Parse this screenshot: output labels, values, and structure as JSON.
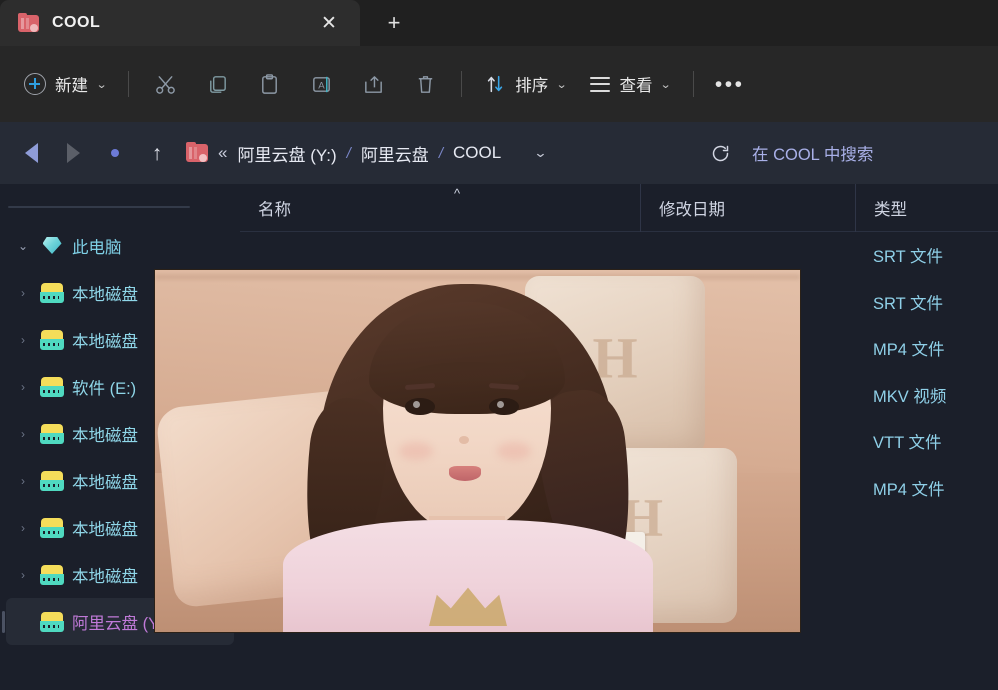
{
  "window": {
    "tab": {
      "title": "COOL",
      "folder_icon": "folder-icon",
      "close_icon": "close-icon"
    },
    "new_tab_icon": "plus-icon"
  },
  "toolbar": {
    "new_label": "新建",
    "new_icon": "plus-circle-icon",
    "caret": "⌄",
    "items": [
      {
        "name": "cut",
        "icon": "scissors-icon"
      },
      {
        "name": "copy",
        "icon": "copy-icon"
      },
      {
        "name": "paste",
        "icon": "clipboard-icon"
      },
      {
        "name": "rename",
        "icon": "rename-icon"
      },
      {
        "name": "share",
        "icon": "share-icon"
      },
      {
        "name": "delete",
        "icon": "trash-icon"
      }
    ],
    "sort_label": "排序",
    "sort_icon": "sort-arrows-icon",
    "view_label": "查看",
    "view_icon": "hamburger-icon",
    "more_label": "•••"
  },
  "addressbar": {
    "back_icon": "back-arrow-icon",
    "forward_icon": "forward-arrow-icon",
    "recent_icon": "recent-dot-icon",
    "up_icon": "up-arrow-icon",
    "folder_icon": "folder-icon",
    "overflow": "«",
    "crumbs": [
      "阿里云盘 (Y:)",
      "阿里云盘",
      "COOL"
    ],
    "separator": "/",
    "caret": "⌄",
    "refresh_icon": "refresh-icon",
    "search_placeholder": "在 COOL 中搜索"
  },
  "sidebar": {
    "items": [
      {
        "label": "此电脑",
        "icon": "diamond-icon",
        "chevron": "⌄",
        "expanded": true,
        "selected": false,
        "style": "pc"
      },
      {
        "label": "本地磁盘",
        "icon": "drive-icon",
        "chevron": "›",
        "expanded": false,
        "selected": false,
        "style": "drive"
      },
      {
        "label": "本地磁盘",
        "icon": "drive-icon",
        "chevron": "›",
        "expanded": false,
        "selected": false,
        "style": "drive"
      },
      {
        "label": "软件 (E:)",
        "icon": "drive-icon",
        "chevron": "›",
        "expanded": false,
        "selected": false,
        "style": "drive"
      },
      {
        "label": "本地磁盘",
        "icon": "drive-icon",
        "chevron": "›",
        "expanded": false,
        "selected": false,
        "style": "drive"
      },
      {
        "label": "本地磁盘",
        "icon": "drive-icon",
        "chevron": "›",
        "expanded": false,
        "selected": false,
        "style": "drive"
      },
      {
        "label": "本地磁盘",
        "icon": "drive-icon",
        "chevron": "›",
        "expanded": false,
        "selected": false,
        "style": "drive"
      },
      {
        "label": "本地磁盘",
        "icon": "drive-icon",
        "chevron": "›",
        "expanded": false,
        "selected": false,
        "style": "drive"
      },
      {
        "label": "阿里云盘 (Y:)",
        "icon": "drive-icon",
        "chevron": "",
        "expanded": false,
        "selected": true,
        "style": "ali"
      }
    ]
  },
  "filelist": {
    "columns": {
      "name": "名称",
      "date": "修改日期",
      "type": "类型"
    },
    "sort_indicator": "^",
    "rows": [
      {
        "name": "",
        "date": "",
        "type": "SRT 文件"
      },
      {
        "name": "",
        "date": "",
        "type": "SRT 文件"
      },
      {
        "name": "",
        "date": "",
        "type": "MP4 文件"
      },
      {
        "name": "",
        "date": "",
        "type": "MKV 视频"
      },
      {
        "name": "",
        "date": "",
        "type": "VTT 文件"
      },
      {
        "name": "",
        "date": "",
        "type": "MP4 文件"
      }
    ]
  },
  "overlay": {
    "name": "image-preview-overlay"
  },
  "colors": {
    "tab_bar": "#202020",
    "tab_active": "#2d2d2d",
    "command_bar": "#272727",
    "address_bar": "#262b36",
    "body": "#1b1f2a",
    "accent_blue": "#2f9fe0",
    "link": "#a9b0e8",
    "type_text": "#8fd0e8",
    "folder_red": "#d9636a"
  }
}
